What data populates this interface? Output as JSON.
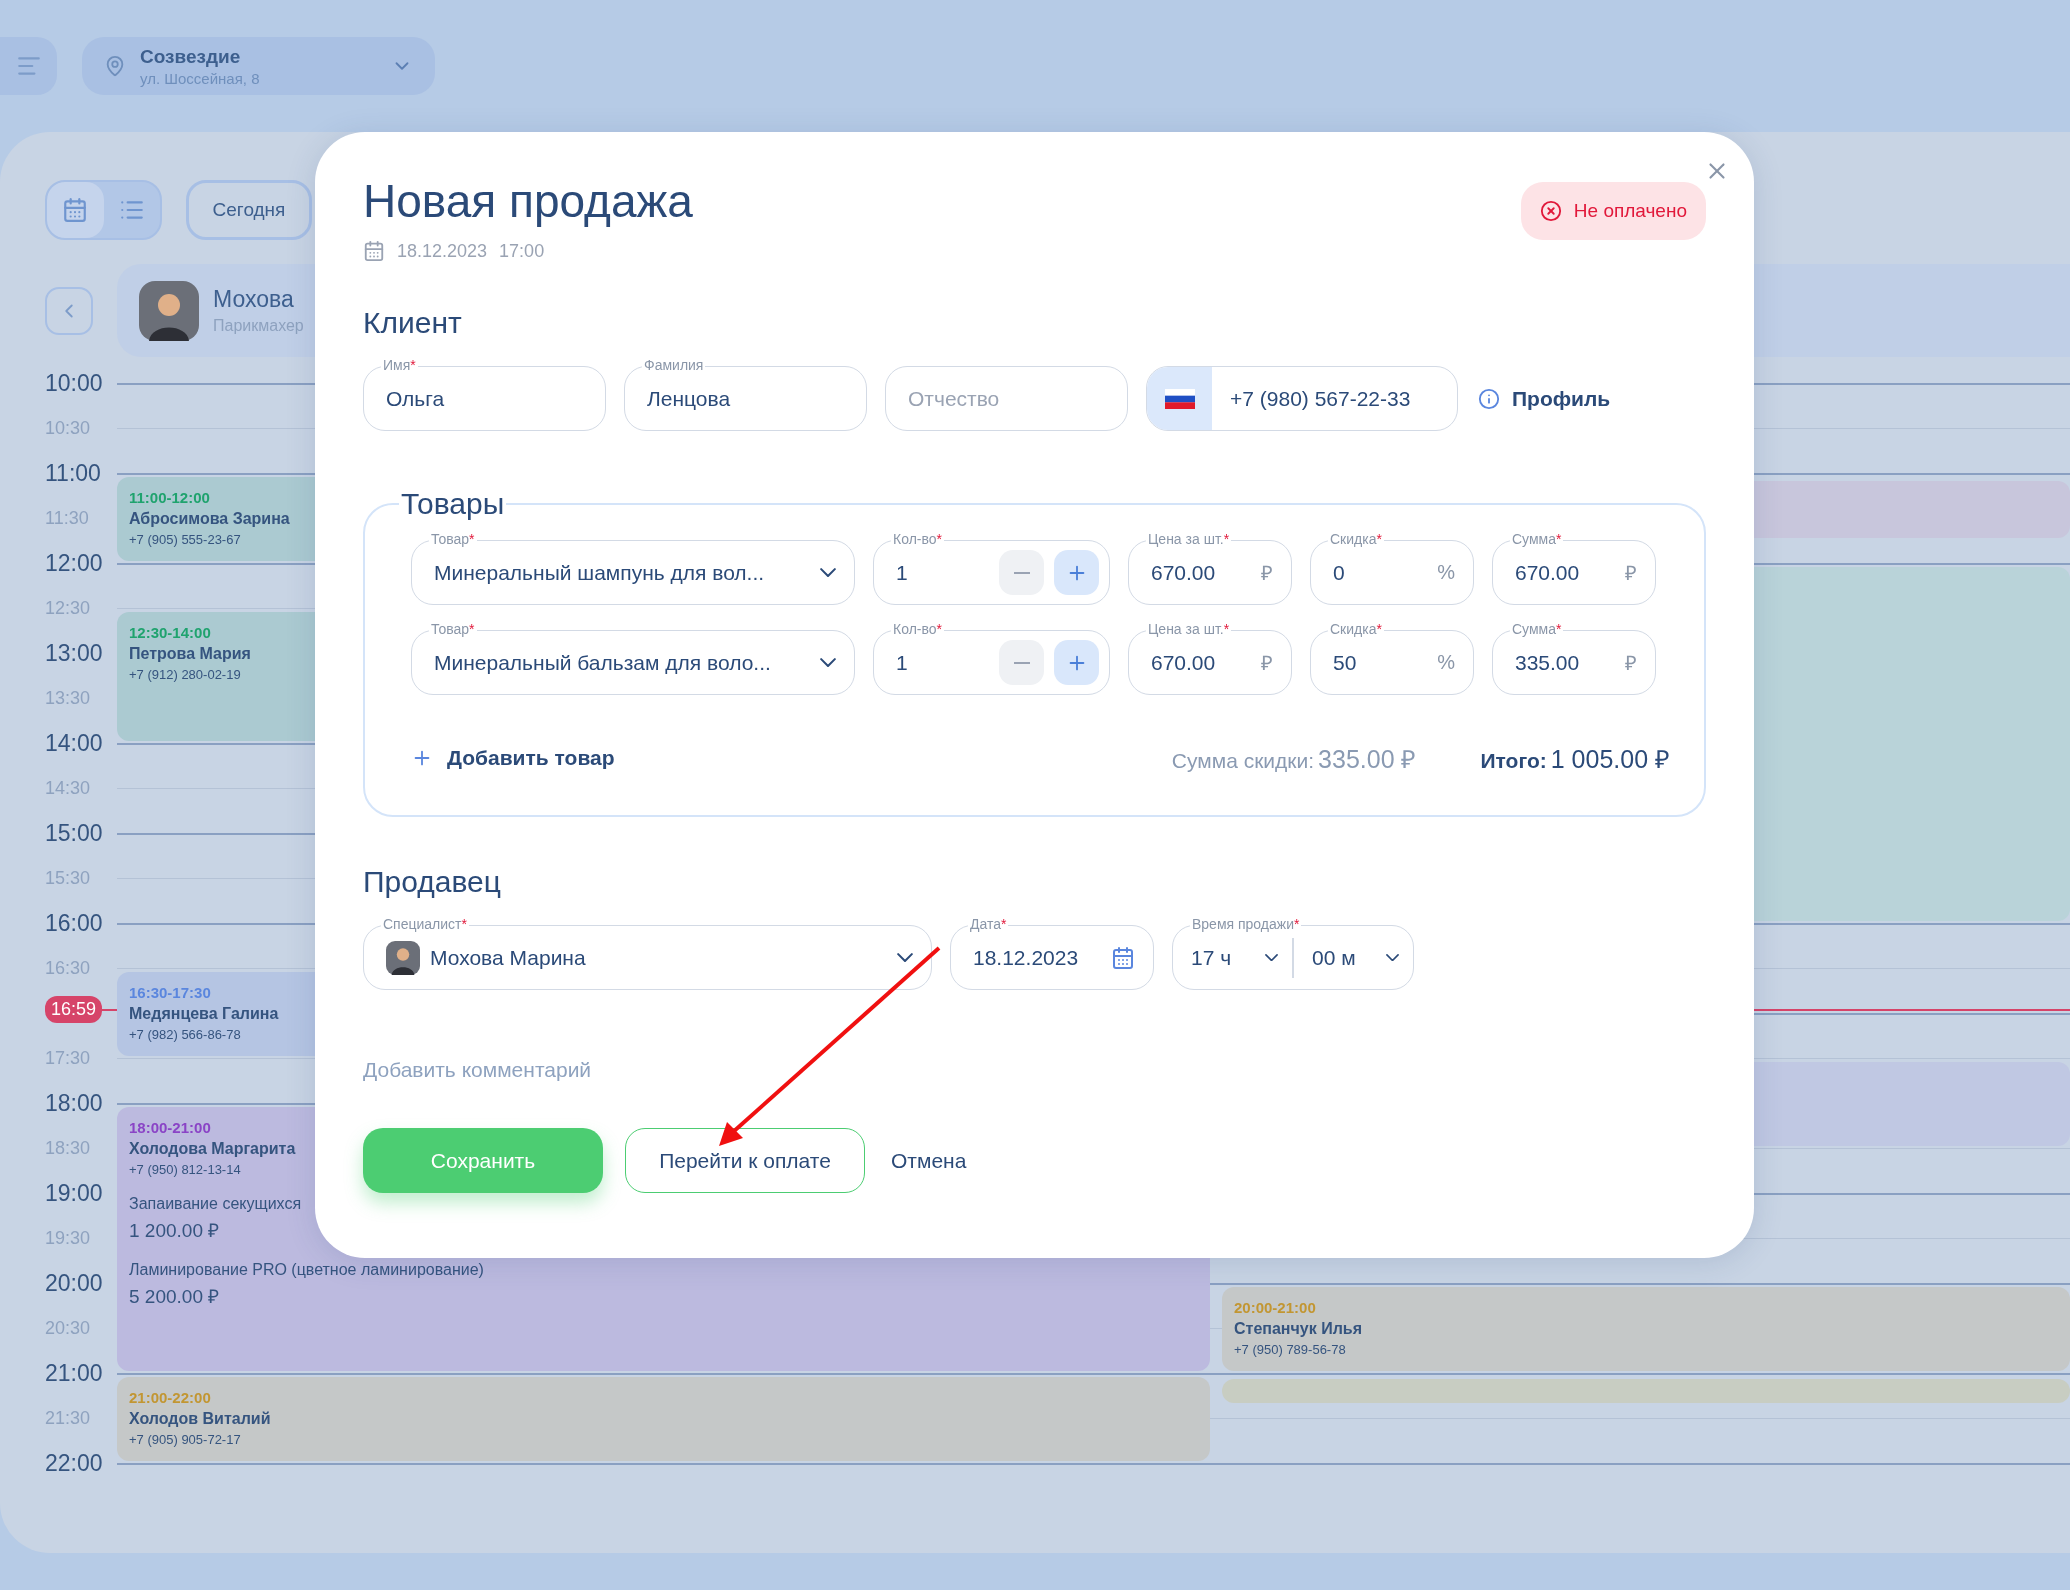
{
  "header": {
    "location": {
      "name": "Созвездие",
      "address": "ул. Шоссейная, 8"
    }
  },
  "toolbar": {
    "view_modes": [
      {
        "kind": "calendar",
        "selected": true
      },
      {
        "kind": "list",
        "selected": false
      }
    ],
    "today_button": "Сегодня"
  },
  "specialist": {
    "name": "Мохова",
    "role": "Парикмахер"
  },
  "timeline": {
    "now": "16:59",
    "times": [
      {
        "label": "10:00",
        "kind": "hour"
      },
      {
        "label": "10:30",
        "kind": "half"
      },
      {
        "label": "11:00",
        "kind": "hour"
      },
      {
        "label": "11:30",
        "kind": "half"
      },
      {
        "label": "12:00",
        "kind": "hour"
      },
      {
        "label": "12:30",
        "kind": "half"
      },
      {
        "label": "13:00",
        "kind": "hour"
      },
      {
        "label": "13:30",
        "kind": "half"
      },
      {
        "label": "14:00",
        "kind": "hour"
      },
      {
        "label": "14:30",
        "kind": "half"
      },
      {
        "label": "15:00",
        "kind": "hour"
      },
      {
        "label": "15:30",
        "kind": "half"
      },
      {
        "label": "16:00",
        "kind": "hour"
      },
      {
        "label": "16:30",
        "kind": "half"
      },
      {
        "kind": "covered"
      },
      {
        "label": "17:30",
        "kind": "half"
      },
      {
        "label": "18:00",
        "kind": "hour"
      },
      {
        "label": "18:30",
        "kind": "half"
      },
      {
        "label": "19:00",
        "kind": "hour"
      },
      {
        "label": "19:30",
        "kind": "half"
      },
      {
        "label": "20:00",
        "kind": "hour"
      },
      {
        "label": "20:30",
        "kind": "half"
      },
      {
        "label": "21:00",
        "kind": "hour"
      },
      {
        "label": "21:30",
        "kind": "half"
      },
      {
        "label": "22:00",
        "kind": "hour"
      }
    ],
    "columns": [
      {
        "events": [
          {
            "time": "11:00-12:00",
            "client": "Абросимова Зарина",
            "phone": "+7 (905) 555-23-67",
            "color": "#1fa36e"
          },
          {
            "time": "12:30-14:00",
            "client": "Петрова Мария",
            "phone": "+7 (912) 280-02-19",
            "color": "#1fa36e"
          },
          {
            "time": "16:30-17:30",
            "client": "Медянцева Галина",
            "phone": "+7 (982) 566-86-78",
            "color": "#5a86de"
          },
          {
            "time": "18:00-21:00",
            "client": "Холодова Маргарита",
            "phone": "+7 (950) 812-13-14",
            "color": "#8a44c6",
            "services": [
              {
                "name": "Запаивание секущихся",
                "price": "1 200.00 ₽"
              },
              {
                "name": "Ламинирование PRO (цветное ламинирование)",
                "price": "5 200.00 ₽"
              }
            ]
          },
          {
            "time": "21:00-22:00",
            "client": "Холодов Виталий",
            "phone": "+7 (905) 905-72-17",
            "color": "#c29632"
          }
        ]
      },
      {
        "events": [
          {
            "color": "#c8c6dc"
          },
          {
            "color": "#b9d3d9"
          },
          {
            "color": "#c0c8e3"
          },
          {
            "time": "20:00-21:00",
            "client": "Степанчук Илья",
            "phone": "+7 (950) 789-56-78",
            "color": "#c29632"
          },
          {
            "color": "#c8cdc2"
          }
        ]
      }
    ]
  },
  "modal": {
    "title": "Новая продажа",
    "date": "18.12.2023",
    "time": "17:00",
    "status": {
      "label": "Не оплачено",
      "paid": false
    },
    "client": {
      "heading": "Клиент",
      "fields": [
        {
          "label": "Имя",
          "mark": "*",
          "value": "Ольга"
        },
        {
          "label": "Фамилия",
          "value": "Ленцова"
        },
        {
          "placeholder": "Отчество"
        }
      ],
      "phone": "+7 (980) 567-22-33",
      "profile_link": "Профиль"
    },
    "products": {
      "heading": "Товары",
      "rows": [
        {
          "product": {
            "label": "Товар",
            "mark": "*",
            "value": "Минеральный шампунь для вол..."
          },
          "qty": {
            "label": "Кол-во",
            "mark": "*",
            "value": "1",
            "minus_disabled": true
          },
          "price": {
            "label": "Цена за шт.",
            "mark": "*",
            "value": "670.00",
            "unit": "₽"
          },
          "discount": {
            "label": "Скидка",
            "mark": "*",
            "value": "0",
            "unit": "%"
          },
          "sum": {
            "label": "Сумма",
            "mark": "*",
            "value": "670.00",
            "unit": "₽"
          }
        },
        {
          "product": {
            "label": "Товар",
            "mark": "*",
            "value": "Минеральный бальзам для воло..."
          },
          "qty": {
            "label": "Кол-во",
            "mark": "*",
            "value": "1",
            "minus_disabled": true
          },
          "price": {
            "label": "Цена за шт.",
            "mark": "*",
            "value": "670.00",
            "unit": "₽"
          },
          "discount": {
            "label": "Скидка",
            "mark": "*",
            "value": "50",
            "unit": "%"
          },
          "sum": {
            "label": "Сумма",
            "mark": "*",
            "value": "335.00",
            "unit": "₽"
          }
        }
      ],
      "add_button": "Добавить товар",
      "discount_total_label": "Сумма скидки:",
      "discount_total": "335.00 ₽",
      "total_label": "Итого:",
      "total": "1 005.00 ₽"
    },
    "seller": {
      "heading": "Продавец",
      "specialist": {
        "label": "Специалист",
        "mark": "*",
        "value": "Мохова Марина"
      },
      "date": {
        "label": "Дата",
        "mark": "*",
        "value": "18.12.2023"
      },
      "time": {
        "label": "Время продажи",
        "mark": "*",
        "hours": "17 ч",
        "minutes": "00 м"
      }
    },
    "comment_link": "Добавить комментарий",
    "buttons": [
      {
        "label": "Сохранить",
        "kind": "primary"
      },
      {
        "label": "Перейти к оплате",
        "kind": "outline"
      },
      {
        "label": "Отмена",
        "kind": "text"
      }
    ],
    "annotations": [
      {
        "kind": "arrow"
      }
    ]
  }
}
